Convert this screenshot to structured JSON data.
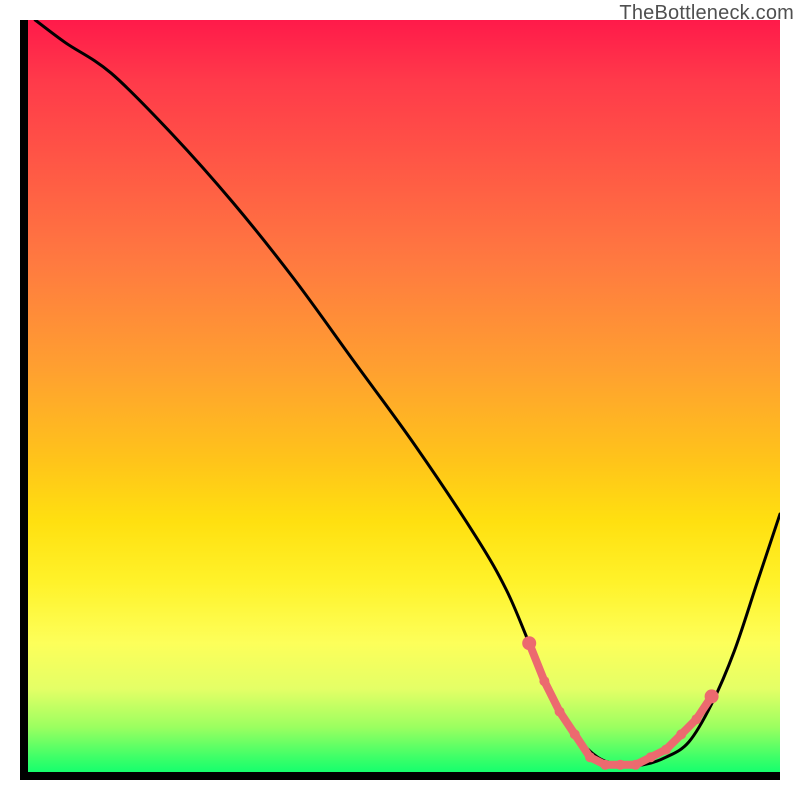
{
  "attribution": "TheBottleneck.com",
  "colors": {
    "axis": "#000000",
    "curve": "#000000",
    "highlight_stroke": "#ec6a6f",
    "highlight_fill": "#ec6a6f"
  },
  "chart_data": {
    "type": "line",
    "title": "",
    "xlabel": "",
    "ylabel": "",
    "xlim": [
      0,
      100
    ],
    "ylim": [
      0,
      100
    ],
    "grid": false,
    "series": [
      {
        "name": "bottleneck-curve",
        "x": [
          2,
          6,
          12,
          20,
          28,
          36,
          44,
          52,
          60,
          64,
          67,
          70,
          73,
          76,
          79,
          82,
          85,
          88,
          91,
          94,
          97,
          100
        ],
        "values": [
          100,
          97,
          93,
          85,
          76,
          66,
          55,
          44,
          32,
          25,
          18,
          11,
          6,
          3,
          2,
          2,
          3,
          5,
          10,
          17,
          26,
          35
        ]
      }
    ],
    "highlight_segment": {
      "description": "salmon dotted region near global minimum",
      "x": [
        67,
        69,
        71,
        73,
        75,
        77,
        79,
        81,
        83,
        85,
        87,
        89,
        91
      ],
      "values": [
        18,
        13,
        9,
        6,
        3,
        2,
        2,
        2,
        3,
        4,
        6,
        8,
        11
      ]
    }
  }
}
